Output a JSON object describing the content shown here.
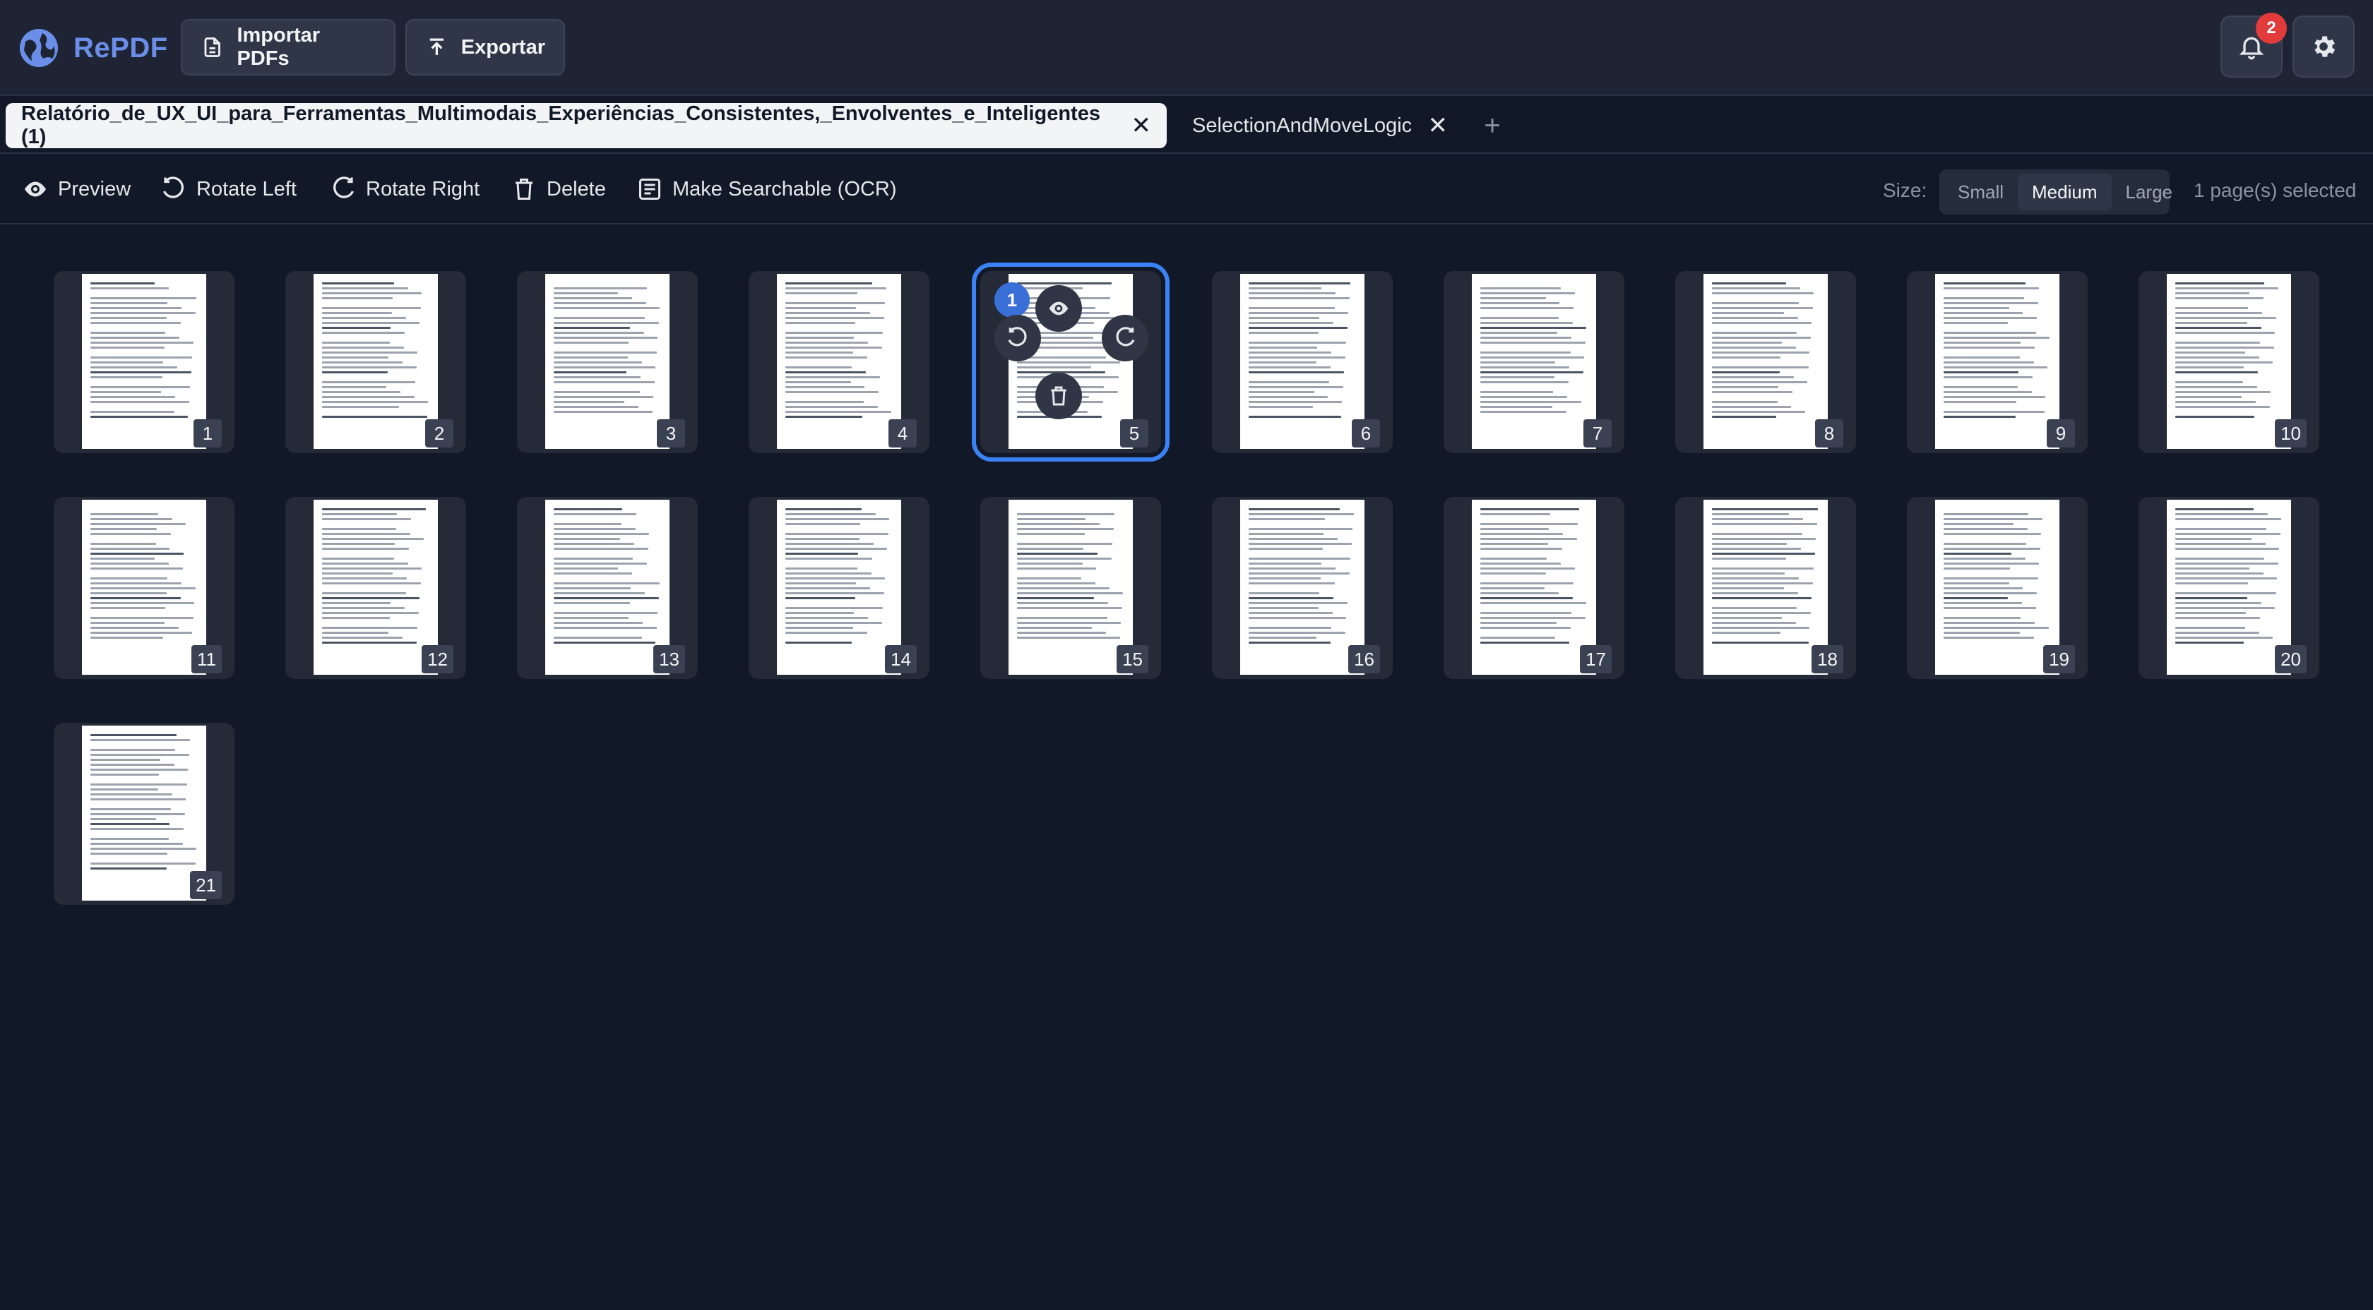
{
  "app": {
    "name": "RePDF",
    "import_label": "Importar PDFs",
    "export_label": "Exportar",
    "notification_count": "2"
  },
  "tabs": [
    {
      "label": "Relatório_de_UX_UI_para_Ferramentas_Multimodais_Experiências_Consistentes,_Envolventes_e_Inteligentes (1)",
      "active": true
    },
    {
      "label": "SelectionAndMoveLogic",
      "active": false
    }
  ],
  "toolbar": {
    "preview": "Preview",
    "rotate_left": "Rotate Left",
    "rotate_right": "Rotate Right",
    "delete": "Delete",
    "ocr": "Make Searchable (OCR)",
    "size_label": "Size:",
    "sizes": [
      "Small",
      "Medium",
      "Large"
    ],
    "selected_size": "Medium",
    "selection_status": "1 page(s) selected"
  },
  "pages": [
    {
      "number": "1"
    },
    {
      "number": "2"
    },
    {
      "number": "3"
    },
    {
      "number": "4"
    },
    {
      "number": "5",
      "selected": true,
      "selection_index": "1"
    },
    {
      "number": "6"
    },
    {
      "number": "7"
    },
    {
      "number": "8"
    },
    {
      "number": "9"
    },
    {
      "number": "10"
    },
    {
      "number": "11"
    },
    {
      "number": "12"
    },
    {
      "number": "13"
    },
    {
      "number": "14"
    },
    {
      "number": "15"
    },
    {
      "number": "16"
    },
    {
      "number": "17"
    },
    {
      "number": "18"
    },
    {
      "number": "19"
    },
    {
      "number": "20"
    },
    {
      "number": "21"
    }
  ],
  "colors": {
    "accent": "#3b82f6",
    "brand": "#6b8fe8",
    "badge": "#e23b3b"
  }
}
